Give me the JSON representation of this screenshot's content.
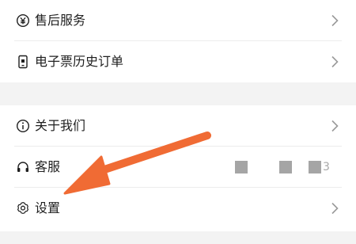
{
  "menu_group_1": {
    "items": [
      {
        "label": "售后服务",
        "icon": "yen-icon"
      },
      {
        "label": "电子票历史订单",
        "icon": "phone-ticket-icon"
      }
    ]
  },
  "menu_group_2": {
    "items": [
      {
        "label": "关于我们",
        "icon": "info-icon"
      },
      {
        "label": "客服",
        "icon": "headset-icon",
        "pixelated_suffix": "3"
      },
      {
        "label": "设置",
        "icon": "gear-icon"
      }
    ]
  },
  "annotation": {
    "arrow_color": "#f06b34",
    "points_to": "设置"
  },
  "colors": {
    "background": "#f3f3f3",
    "card": "#ffffff",
    "text": "#1f1f1f",
    "chevron": "#9a9a9a"
  }
}
